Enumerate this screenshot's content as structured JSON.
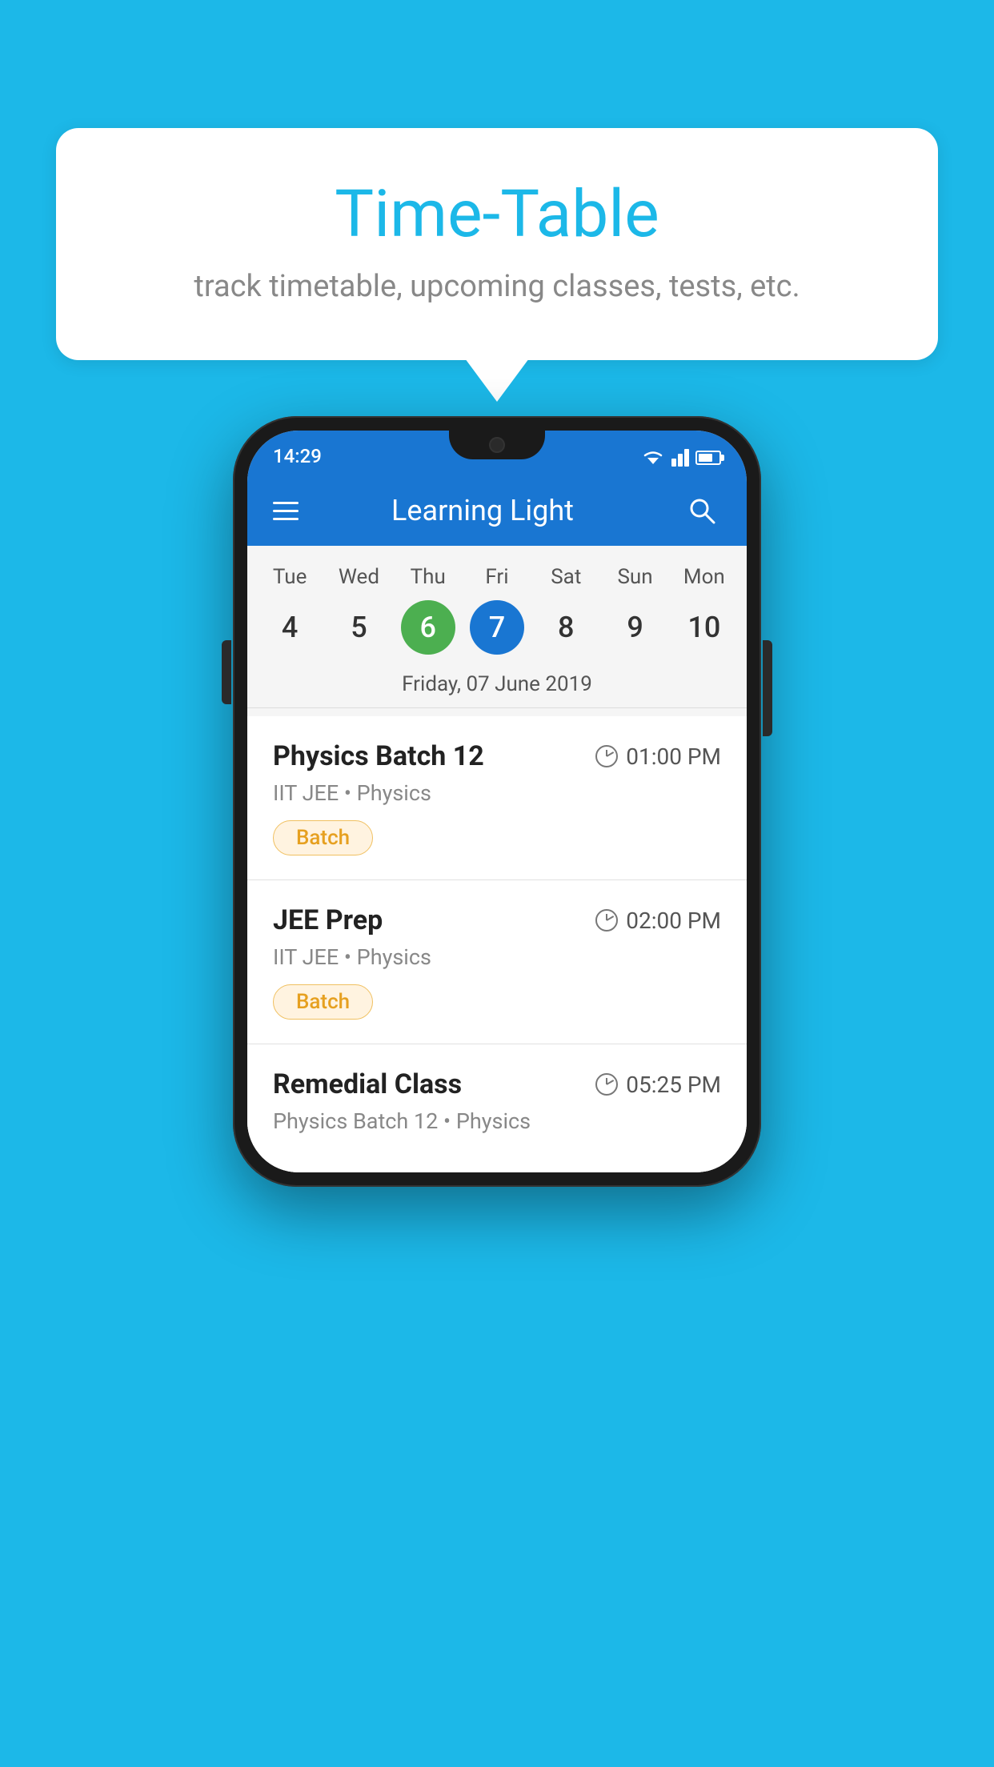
{
  "page": {
    "background_color": "#1cb8e8"
  },
  "bubble": {
    "title": "Time-Table",
    "subtitle": "track timetable, upcoming classes, tests, etc."
  },
  "phone": {
    "status_bar": {
      "time": "14:29"
    },
    "app_bar": {
      "title": "Learning Light"
    },
    "calendar": {
      "selected_date_label": "Friday, 07 June 2019",
      "day_labels": [
        "Tue",
        "Wed",
        "Thu",
        "Fri",
        "Sat",
        "Sun",
        "Mon"
      ],
      "dates": [
        {
          "number": "4",
          "state": "normal"
        },
        {
          "number": "5",
          "state": "normal"
        },
        {
          "number": "6",
          "state": "today"
        },
        {
          "number": "7",
          "state": "selected"
        },
        {
          "number": "8",
          "state": "normal"
        },
        {
          "number": "9",
          "state": "normal"
        },
        {
          "number": "10",
          "state": "normal"
        }
      ]
    },
    "schedule_items": [
      {
        "title": "Physics Batch 12",
        "time": "01:00 PM",
        "subtitle": "IIT JEE • Physics",
        "tag": "Batch"
      },
      {
        "title": "JEE Prep",
        "time": "02:00 PM",
        "subtitle": "IIT JEE • Physics",
        "tag": "Batch"
      },
      {
        "title": "Remedial Class",
        "time": "05:25 PM",
        "subtitle": "Physics Batch 12 • Physics",
        "tag": ""
      }
    ]
  }
}
